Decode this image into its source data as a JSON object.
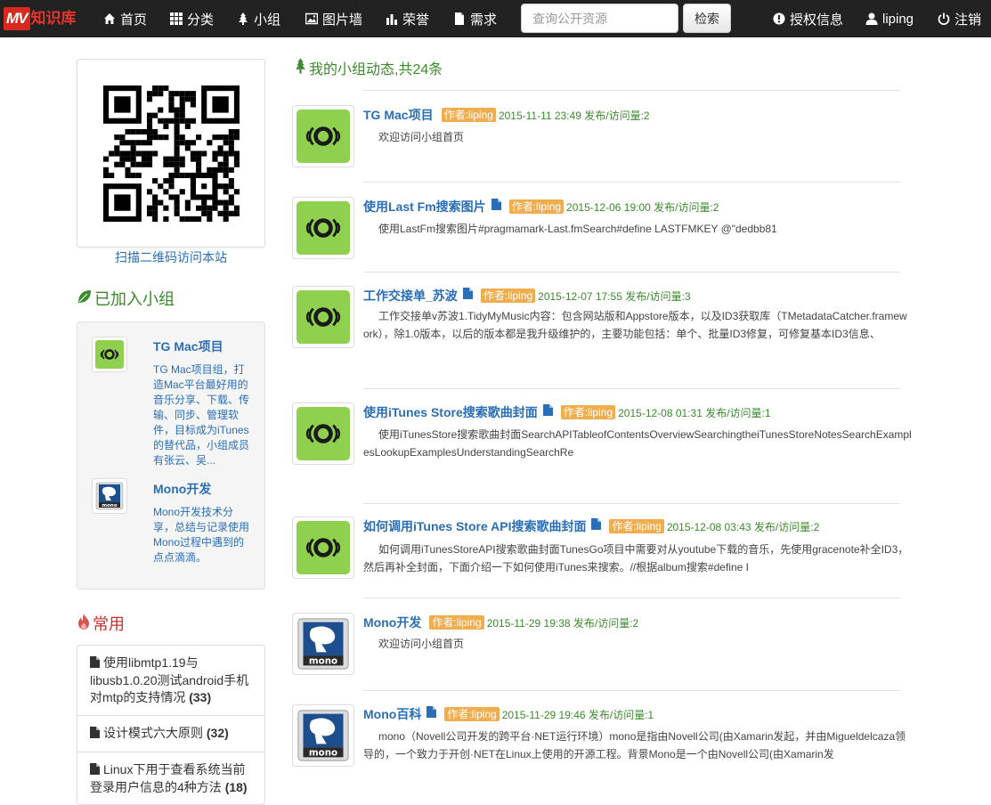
{
  "nav": {
    "brand_mv": "MV",
    "brand_text": "知识库",
    "items": [
      {
        "label": "首页",
        "icon": "home-icon"
      },
      {
        "label": "分类",
        "icon": "grid-icon"
      },
      {
        "label": "小组",
        "icon": "tree-icon"
      },
      {
        "label": "图片墙",
        "icon": "picture-icon"
      },
      {
        "label": "荣誉",
        "icon": "bar-chart-icon"
      },
      {
        "label": "需求",
        "icon": "file-icon"
      }
    ],
    "search_placeholder": "查询公开资源",
    "search_button": "检索",
    "right": [
      {
        "label": "授权信息",
        "icon": "exclamation-circle-icon"
      },
      {
        "label": "liping",
        "icon": "user-icon"
      },
      {
        "label": "注销",
        "icon": "power-icon"
      }
    ]
  },
  "sidebar": {
    "qr_caption": "扫描二维码访问本站",
    "joined_title": "已加入小组",
    "groups": [
      {
        "name": "TG Mac项目",
        "desc": "TG Mac项目组，打造Mac平台最好用的音乐分享、下载、传输、同步、管理软件，目标成为iTunes的替代品，小组成员有张云、吴..."
      },
      {
        "name": "Mono开发",
        "desc": "Mono开发技术分享，总结与记录使用Mono过程中遇到的点点滴滴。"
      }
    ],
    "common_title": "常用",
    "common": [
      {
        "text": "使用libmtp1.19与libusb1.0.20测试android手机对mtp的支持情况",
        "count": "(33)"
      },
      {
        "text": "设计模式六大原则",
        "count": "(32)"
      },
      {
        "text": "Linux下用于查看系统当前登录用户信息的4种方法",
        "count": "(18)"
      }
    ]
  },
  "feed": {
    "title": "我的小组动态,共24条",
    "items": [
      {
        "title": "TG Mac项目",
        "doc": false,
        "author": "作者:liping",
        "meta": "2015-11-11 23:49 发布/访问量:2",
        "body": "欢迎访问小组首页",
        "thumb": "tgmac"
      },
      {
        "title": "使用Last Fm搜索图片",
        "doc": true,
        "author": "作者:liping",
        "meta": "2015-12-06 19:00 发布/访问量:2",
        "body": "使用LastFm搜索图片#pragmamark-Last.fmSearch#define  LASTFMKEY        @\"dedbb81",
        "thumb": "tgmac"
      },
      {
        "title": "工作交接单_苏波",
        "doc": true,
        "author": "作者:liping",
        "meta": "2015-12-07 17:55 发布/访问量:3",
        "body": "工作交接单v苏波1.TidyMyMusic内容：包含网站版和Appstore版本，以及ID3获取库（TMetadataCatcher.framework），除1.0版本，以后的版本都是我升级维护的，主要功能包括：单个、批量ID3修复，可修复基本ID3信息、",
        "thumb": "tgmac"
      },
      {
        "title": "使用iTunes Store搜索歌曲封面",
        "doc": true,
        "author": "作者:liping",
        "meta": "2015-12-08 01:31 发布/访问量:1",
        "body": "使用iTunesStore搜索歌曲封面SearchAPITableofContentsOverviewSearchingtheiTunesStoreNotesSearchExamplesLookupExamplesUnderstandingSearchRe",
        "thumb": "tgmac"
      },
      {
        "title": "如何调用iTunes Store API搜索歌曲封面",
        "doc": true,
        "author": "作者:liping",
        "meta": "2015-12-08 03:43 发布/访问量:2",
        "body": "如何调用iTunesStoreAPI搜索歌曲封面TunesGo项目中需要对从youtube下载的音乐，先使用gracenote补全ID3，然后再补全封面，下面介绍一下如何使用iTunes来搜索。//根据album搜索#define  I",
        "thumb": "tgmac"
      },
      {
        "title": "Mono开发",
        "doc": false,
        "author": "作者:liping",
        "meta": "2015-11-29 19:38 发布/访问量:2",
        "body": "欢迎访问小组首页",
        "thumb": "mono"
      },
      {
        "title": "Mono百科",
        "doc": true,
        "author": "作者:liping",
        "meta": "2015-11-29 19:46 发布/访问量:1",
        "body": "mono（Novell公司开发的跨平台·NET运行环境）mono是指由Novell公司(由Xamarin发起，并由Migueldelcaza领导的，一个致力于开创·NET在Linux上使用的开源工程。背景Mono是一个由Novell公司(由Xamarin发",
        "thumb": "mono"
      }
    ]
  },
  "thumbs": {
    "tgmac": "tg-mac-logo",
    "mono": "mono-logo",
    "mono_text": "mono"
  },
  "colors": {
    "navbar": "#222222",
    "brand_red": "#d9281e",
    "link_blue": "#2a6eb5",
    "green": "#3b8a2c",
    "badge_orange": "#f0ad4e",
    "tg_green": "#8fd14f"
  }
}
